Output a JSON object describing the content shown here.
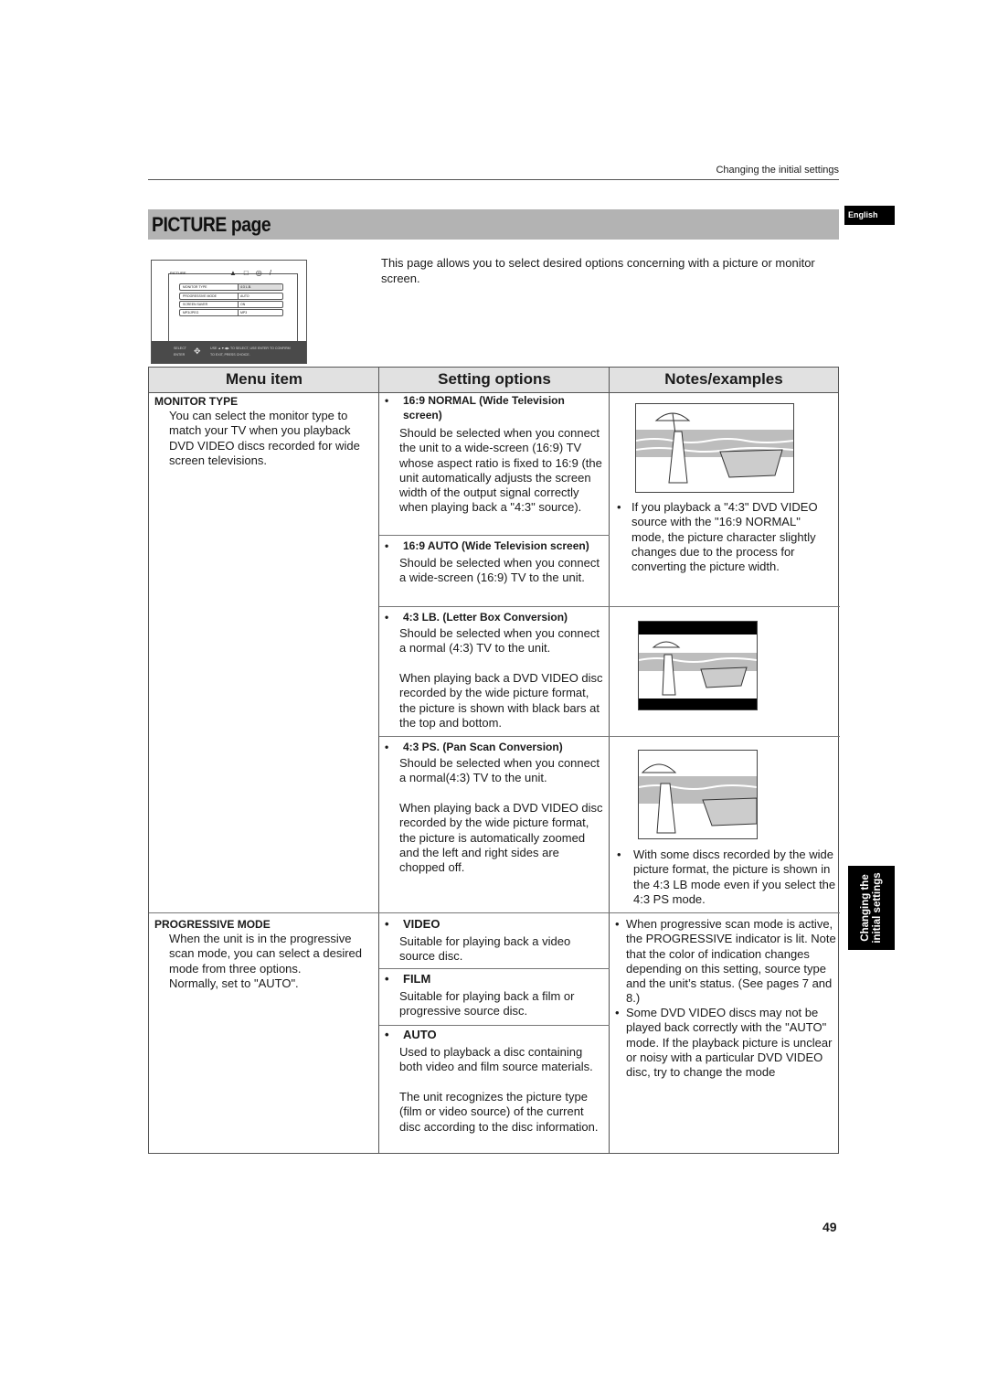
{
  "header": {
    "running_head": "Changing the initial settings",
    "language_tab": "English",
    "page_title": "PICTURE page",
    "intro": "This page allows you to select desired options concerning with a picture or monitor screen."
  },
  "osd": {
    "tab_label": "PICTURE",
    "rows": [
      {
        "label": "MONITOR TYPE",
        "value": "4:3 L.B."
      },
      {
        "label": "PROGRESSIVE MODE",
        "value": "AUTO"
      },
      {
        "label": "SCREEN SAVER",
        "value": "ON"
      },
      {
        "label": "MP3/JPEG",
        "value": "MP3"
      }
    ],
    "footer_left_1": "SELECT",
    "footer_left_2": "ENTER",
    "footer_text_1": "USE ▲▼◀▶ TO SELECT, USE ENTER TO CONFIRM",
    "footer_text_2": "TO EXIT, PRESS CHOICE."
  },
  "table": {
    "headers": [
      "Menu item",
      "Setting options",
      "Notes/examples"
    ],
    "monitor_type": {
      "title": "MONITOR TYPE",
      "description": "You can select the monitor type to match your TV when you playback DVD VIDEO discs recorded for wide screen televisions.",
      "options": [
        {
          "title_line1": "16:9 NORMAL (Wide Television",
          "title_line2": "screen)",
          "desc": "Should be selected when you connect the unit to a wide-screen (16:9) TV whose aspect ratio is fixed to 16:9 (the unit automatically adjusts the screen width of the output signal correctly when playing back a \"4:3\" source)."
        },
        {
          "title_line1": "16:9 AUTO (Wide Television screen)",
          "desc": "Should be selected when you connect a wide-screen (16:9) TV to the unit."
        },
        {
          "title_line1": "4:3 LB. (Letter Box Conversion)",
          "desc": "Should be selected when you connect a normal (4:3) TV to the unit.",
          "desc2": "When playing back a DVD VIDEO disc recorded by the wide picture format, the picture is shown with black bars at the top and bottom."
        },
        {
          "title_line1": "4:3 PS. (Pan Scan Conversion)",
          "desc": "Should be selected when you connect a normal(4:3) TV to the unit.",
          "desc2": "When playing back a DVD VIDEO disc recorded by the wide picture format, the picture is automatically zoomed and the left and right sides are chopped off."
        }
      ],
      "notes": [
        "If you playback a \"4:3\" DVD VIDEO source with the \"16:9 NORMAL\" mode, the picture character slightly changes due to the process for converting the picture width.",
        "With some discs recorded by the wide picture format, the picture is shown in the 4:3 LB mode even if you select the 4:3 PS mode."
      ]
    },
    "progressive_mode": {
      "title": "PROGRESSIVE MODE",
      "description": "When the unit is in the progressive scan mode, you can select a desired mode from three options.",
      "description2": "Normally, set to \"AUTO\".",
      "options": [
        {
          "title": "VIDEO",
          "desc": "Suitable for playing back a video source disc."
        },
        {
          "title": "FILM",
          "desc": "Suitable for playing back a film or progressive source disc."
        },
        {
          "title": "AUTO",
          "desc": "Used to playback a disc containing both video and film source materials.",
          "desc2": "The unit recognizes the picture type (film or video source) of the current disc according to the disc information."
        }
      ],
      "notes": [
        "When progressive scan mode is active, the PROGRESSIVE indicator is lit. Note that the color of indication changes depending on this setting, source type and the unit’s status. (See pages 7 and 8.)",
        "Some DVD VIDEO discs may not be played back correctly with the \"AUTO\" mode. If the playback picture is unclear or noisy with a particular DVD VIDEO disc, try to change the mode"
      ]
    }
  },
  "side_tab": {
    "line1": "Changing the",
    "line2": "initial settings"
  },
  "page_number": "49",
  "icons": {
    "bullet": "•"
  }
}
